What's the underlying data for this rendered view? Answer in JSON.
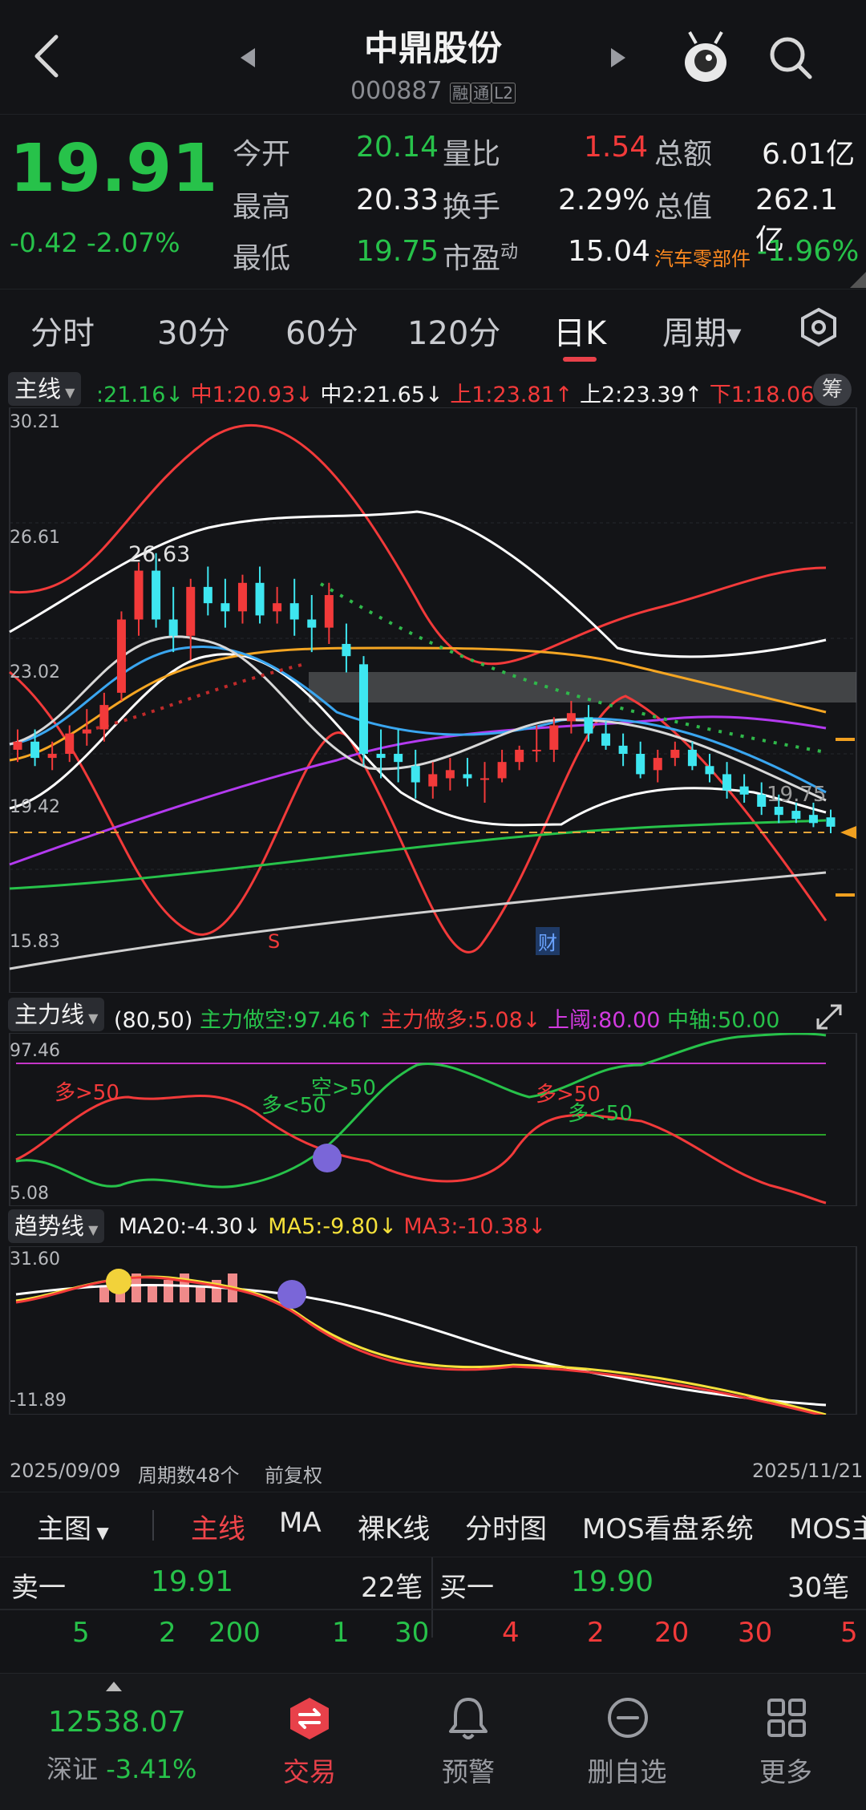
{
  "header": {
    "title": "中鼎股份",
    "code": "000887",
    "badges": [
      "融",
      "通",
      "L2"
    ]
  },
  "quote": {
    "price": "19.91",
    "change": "-0.42",
    "change_pct": "-2.07%",
    "stats": [
      {
        "label": "今开",
        "value": "20.14",
        "color": "green"
      },
      {
        "label": "最高",
        "value": "20.33",
        "color": "white"
      },
      {
        "label": "最低",
        "value": "19.75",
        "color": "green"
      }
    ],
    "stats2": [
      {
        "label": "量比",
        "value": "1.54",
        "color": "red"
      },
      {
        "label": "换手",
        "value": "2.29%",
        "color": "white"
      },
      {
        "label": "市盈",
        "sup": "动",
        "value": "15.04",
        "color": "white"
      }
    ],
    "stats3": [
      {
        "label": "总额",
        "value": "6.01亿"
      },
      {
        "label": "总值",
        "value": "262.1亿"
      }
    ],
    "sector": "汽车零部件",
    "sector_change": "-1.96%"
  },
  "periods": [
    "分时",
    "30分",
    "60分",
    "120分",
    "日K",
    "周期"
  ],
  "active_period": "日K",
  "main_legend": {
    "pill": "主线",
    "items": [
      {
        "text": ":21.16↓",
        "color": "green"
      },
      {
        "text": "中1:20.93↓",
        "color": "red"
      },
      {
        "text": "中2:21.65↓",
        "color": "white"
      },
      {
        "text": "上1:23.81↑",
        "color": "red"
      },
      {
        "text": "上2:23.39↑",
        "color": "white"
      },
      {
        "text": "下1:18.06↓",
        "color": "red"
      }
    ],
    "chip": "筹"
  },
  "main_axis": [
    "30.21",
    "26.61",
    "23.02",
    "19.42",
    "15.83"
  ],
  "main_annotations": {
    "high": "26.63",
    "low": "19.75",
    "s": "S",
    "cai": "财"
  },
  "main_chart_data": {
    "type": "candlestick",
    "ylim": [
      15.83,
      30.21
    ],
    "x_start": "2025/09/09",
    "x_end": "2025/11/21",
    "candles": [
      [
        21.8,
        22.3,
        21.5,
        22.0
      ],
      [
        22.0,
        22.3,
        21.4,
        21.6
      ],
      [
        21.6,
        22.0,
        21.3,
        21.7
      ],
      [
        21.7,
        22.4,
        21.5,
        22.2
      ],
      [
        22.2,
        22.8,
        21.9,
        22.3
      ],
      [
        22.3,
        23.2,
        22.0,
        22.9
      ],
      [
        23.2,
        25.2,
        23.0,
        25.0
      ],
      [
        25.0,
        26.4,
        24.6,
        26.2
      ],
      [
        26.2,
        26.63,
        24.8,
        25.0
      ],
      [
        25.0,
        25.8,
        24.2,
        24.6
      ],
      [
        24.6,
        26.0,
        24.0,
        25.8
      ],
      [
        25.8,
        26.3,
        25.1,
        25.4
      ],
      [
        25.4,
        26.0,
        24.8,
        25.2
      ],
      [
        25.2,
        26.1,
        24.9,
        25.9
      ],
      [
        25.9,
        26.3,
        24.9,
        25.1
      ],
      [
        25.2,
        25.8,
        24.9,
        25.4
      ],
      [
        25.4,
        26.0,
        24.6,
        25.0
      ],
      [
        25.0,
        25.6,
        24.2,
        24.8
      ],
      [
        24.8,
        25.9,
        24.4,
        25.6
      ],
      [
        24.4,
        24.9,
        23.7,
        24.1
      ],
      [
        23.9,
        24.1,
        21.4,
        21.7
      ],
      [
        21.7,
        22.3,
        21.1,
        21.6
      ],
      [
        21.7,
        22.3,
        21.0,
        21.5
      ],
      [
        21.4,
        21.8,
        20.6,
        21.0
      ],
      [
        20.9,
        21.5,
        20.6,
        21.2
      ],
      [
        21.1,
        21.6,
        20.8,
        21.3
      ],
      [
        21.2,
        21.6,
        20.9,
        21.1
      ],
      [
        21.1,
        21.5,
        20.5,
        21.1
      ],
      [
        21.1,
        21.8,
        21.0,
        21.5
      ],
      [
        21.5,
        21.9,
        21.3,
        21.8
      ],
      [
        21.8,
        22.4,
        21.5,
        21.8
      ],
      [
        21.8,
        22.6,
        21.5,
        22.4
      ],
      [
        22.5,
        23.0,
        22.2,
        22.7
      ],
      [
        22.6,
        22.9,
        22.0,
        22.2
      ],
      [
        22.2,
        22.5,
        21.8,
        21.9
      ],
      [
        21.9,
        22.2,
        21.4,
        21.7
      ],
      [
        21.7,
        22.0,
        21.1,
        21.2
      ],
      [
        21.3,
        21.8,
        21.0,
        21.6
      ],
      [
        21.6,
        22.0,
        21.4,
        21.8
      ],
      [
        21.8,
        22.0,
        21.3,
        21.4
      ],
      [
        21.4,
        21.7,
        21.0,
        21.2
      ],
      [
        21.2,
        21.5,
        20.6,
        20.8
      ],
      [
        20.9,
        21.2,
        20.5,
        20.7
      ],
      [
        20.7,
        21.0,
        20.2,
        20.4
      ],
      [
        20.4,
        20.7,
        20.0,
        20.2
      ],
      [
        20.3,
        20.5,
        20.0,
        20.1
      ],
      [
        20.2,
        20.5,
        19.9,
        20.0
      ],
      [
        20.14,
        20.33,
        19.75,
        19.91
      ]
    ]
  },
  "sub1_legend": {
    "pill": "主力线",
    "items": [
      {
        "text": "(80,50)",
        "color": "white"
      },
      {
        "text": "主力做空:97.46↑",
        "color": "green"
      },
      {
        "text": "主力做多:5.08↓",
        "color": "red"
      },
      {
        "text": "上阈:80.00",
        "color": "purple"
      },
      {
        "text": "中轴:50.00",
        "color": "green"
      }
    ]
  },
  "sub1_axis": [
    "97.46",
    "5.08"
  ],
  "sub1_labels": [
    "多>50",
    "多<50",
    "空>50",
    "多>50",
    "多<50"
  ],
  "sub2_legend": {
    "pill": "趋势线",
    "items": [
      {
        "text": "MA20:-4.30↓",
        "color": "white"
      },
      {
        "text": "MA5:-9.80↓",
        "color": "yellow"
      },
      {
        "text": "MA3:-10.38↓",
        "color": "red"
      }
    ]
  },
  "sub2_axis": [
    "31.60",
    "-11.89"
  ],
  "footer_dates": {
    "start": "2025/09/09",
    "count": "周期数48个",
    "adj": "前复权",
    "end": "2025/11/21"
  },
  "bottom_tabs": [
    "主图",
    "主线",
    "MA",
    "裸K线",
    "分时图",
    "MOS看盘系统",
    "MOS主"
  ],
  "orderbook": {
    "sell": {
      "label": "卖一",
      "price": "19.91",
      "count": "22笔",
      "qty": [
        "5",
        "2",
        "200",
        "1",
        "30"
      ]
    },
    "buy": {
      "label": "买一",
      "price": "19.90",
      "count": "30笔",
      "qty": [
        "4",
        "2",
        "20",
        "30",
        "5"
      ]
    }
  },
  "nav": {
    "index_value": "12538.07",
    "index_name": "深证",
    "index_change": "-3.41%",
    "items": [
      "交易",
      "预警",
      "删自选",
      "更多"
    ]
  },
  "colors": {
    "up": "#f23a3a",
    "down": "#27c24a",
    "accent": "#e8414a",
    "bg": "#131417"
  }
}
